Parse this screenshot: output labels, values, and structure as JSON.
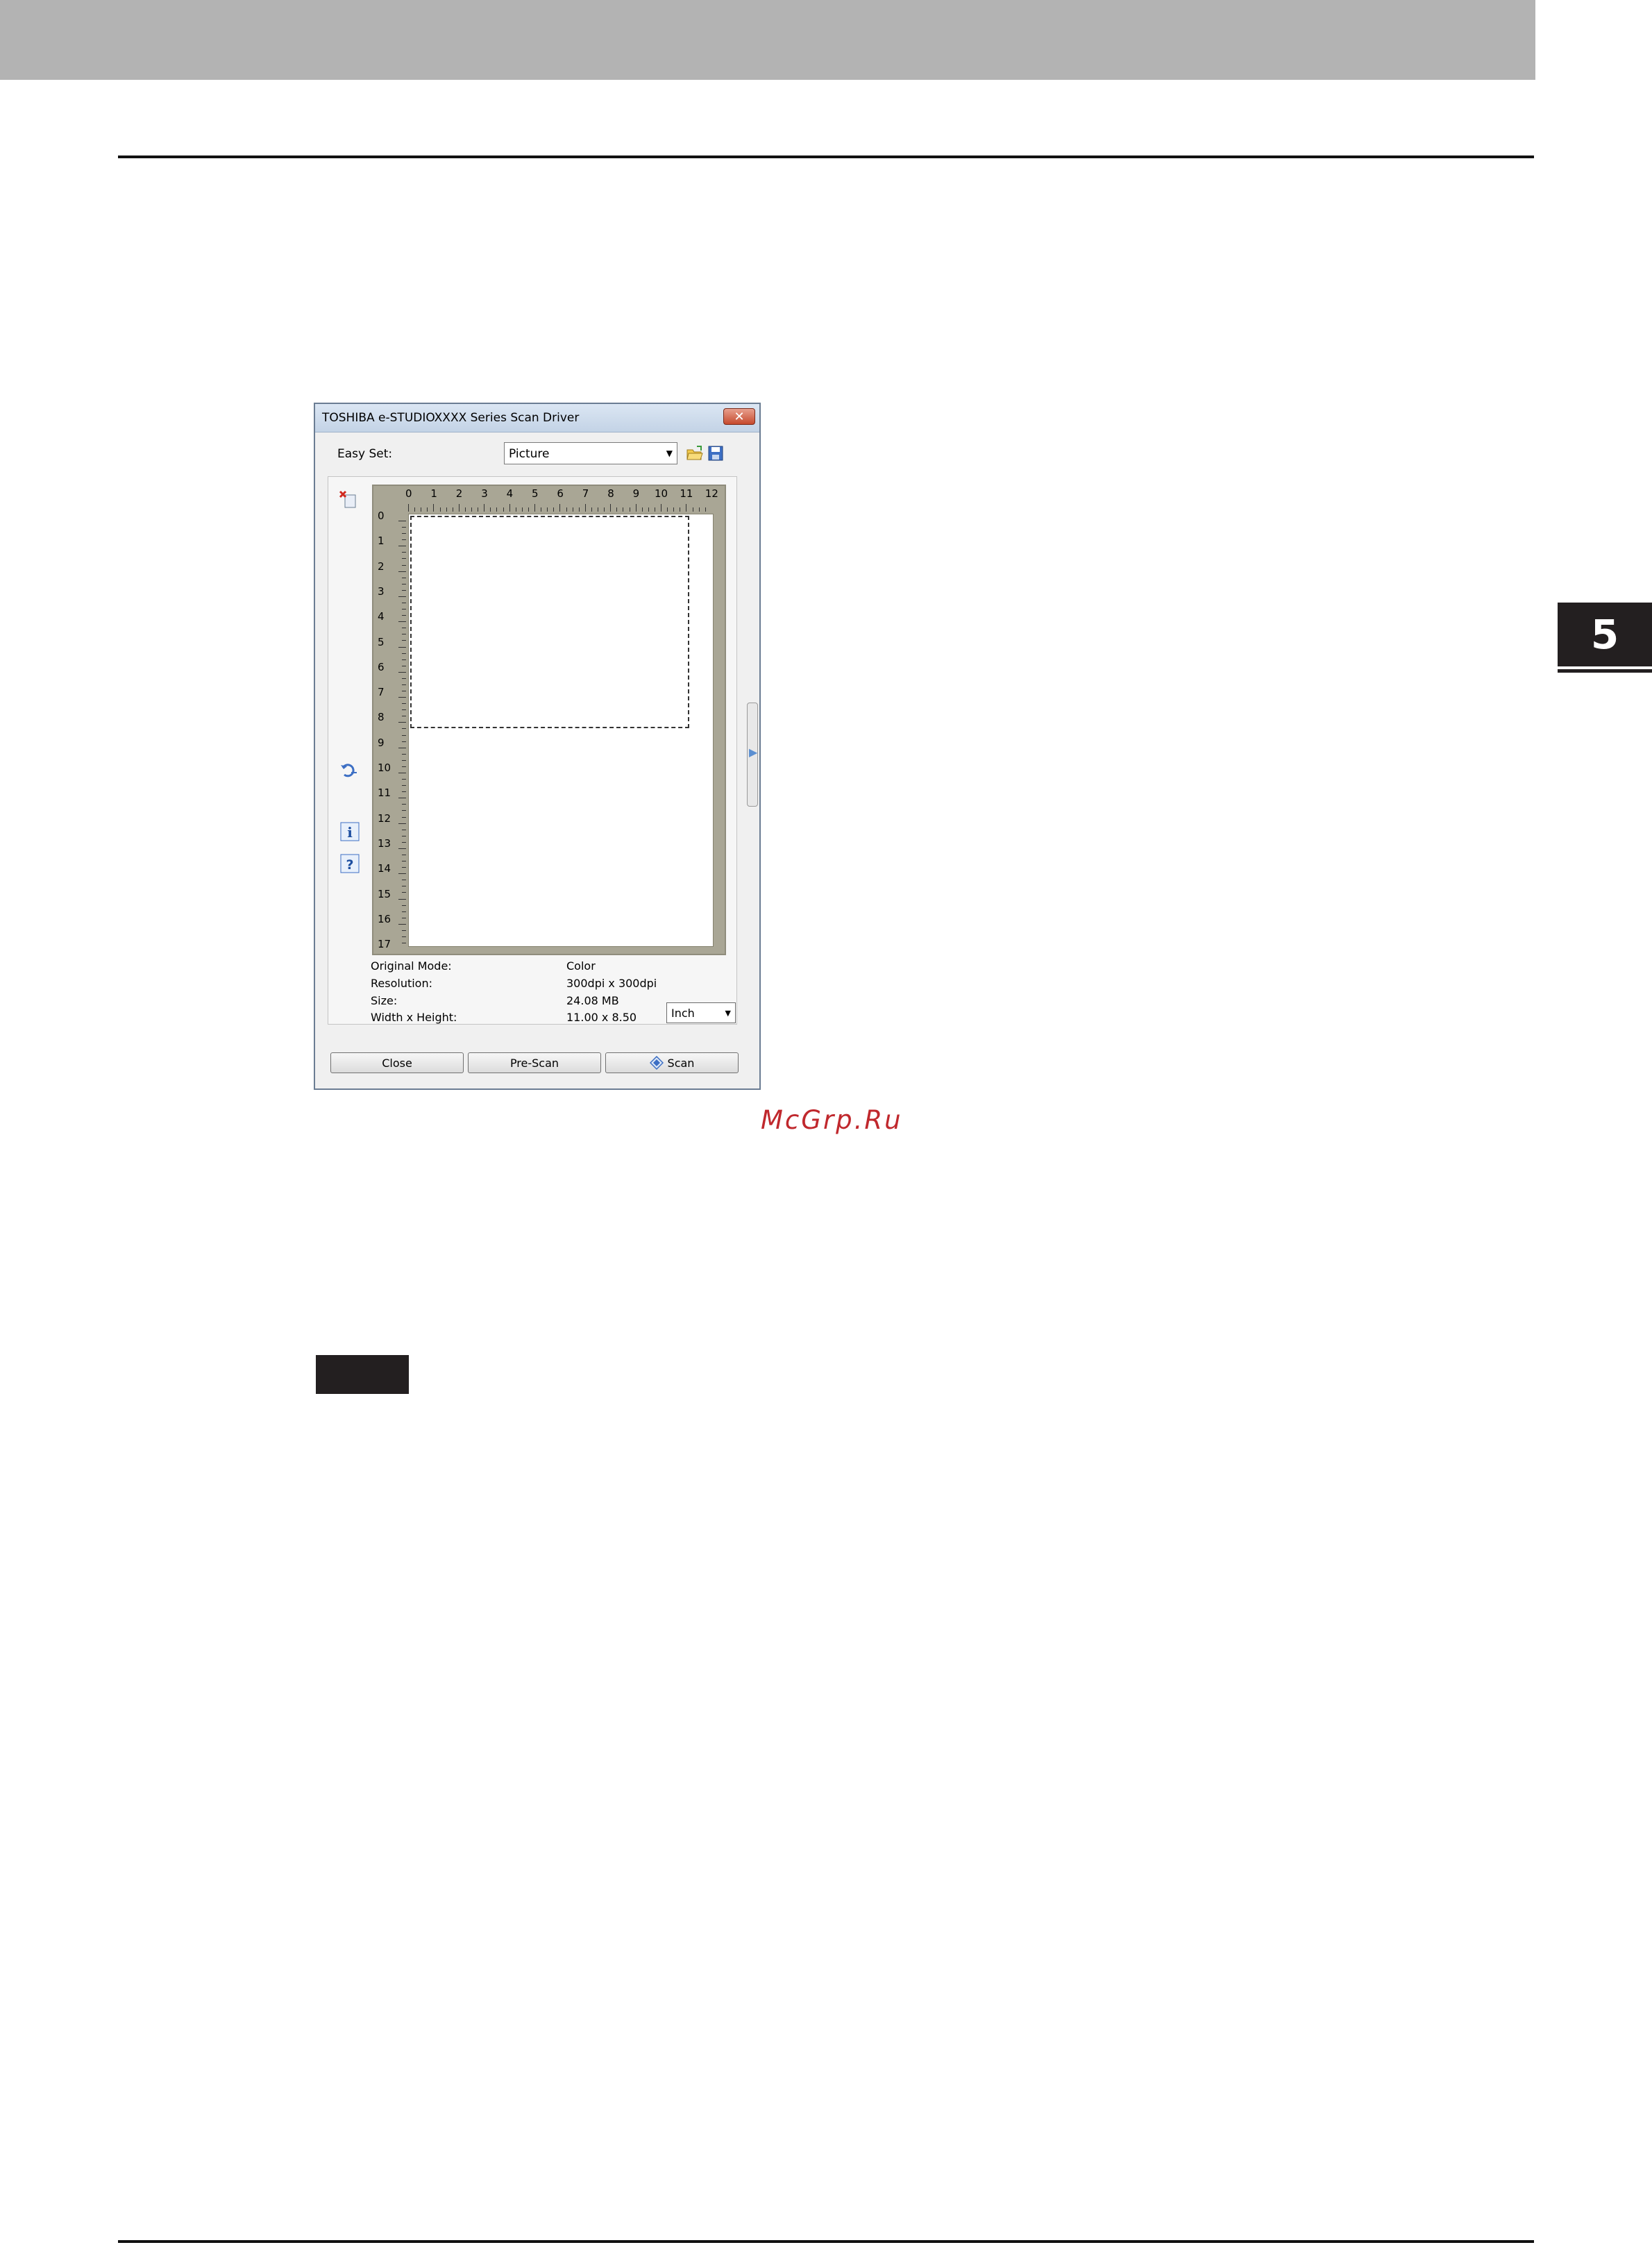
{
  "chapter_tab": "5",
  "watermark": "McGrp.Ru",
  "dialog": {
    "title": "TOSHIBA e-STUDIOXXXX Series Scan Driver",
    "close_glyph": "✕",
    "easy_set_label": "Easy Set:",
    "easy_set_value": "Picture",
    "icons": {
      "open": "folder-open-icon",
      "save": "save-icon",
      "delete": "delete-page-icon",
      "rotate": "rotate-icon",
      "info": "info-icon",
      "help": "help-icon"
    },
    "ruler": {
      "top": [
        "0",
        "1",
        "2",
        "3",
        "4",
        "5",
        "6",
        "7",
        "8",
        "9",
        "10",
        "11",
        "12"
      ],
      "left": [
        "0",
        "1",
        "2",
        "3",
        "4",
        "5",
        "6",
        "7",
        "8",
        "9",
        "10",
        "11",
        "12",
        "13",
        "14",
        "15",
        "16",
        "17"
      ]
    },
    "info": {
      "original_mode_label": "Original Mode:",
      "original_mode_value": "Color",
      "resolution_label": "Resolution:",
      "resolution_value": "300dpi x 300dpi",
      "size_label": "Size:",
      "size_value": "24.08 MB",
      "wh_label": "Width x Height:",
      "wh_value": "11.00 x 8.50"
    },
    "unit": "Inch",
    "buttons": {
      "close": "Close",
      "prescan": "Pre-Scan",
      "scan": "Scan"
    }
  }
}
